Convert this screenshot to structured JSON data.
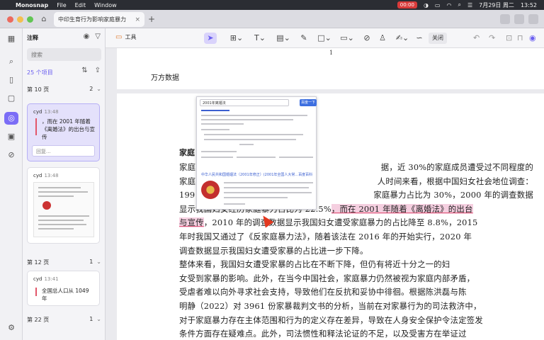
{
  "menubar": {
    "app_name": "Monosnap",
    "menus": [
      "File",
      "Edit",
      "Window"
    ],
    "recording": "00:00",
    "datetime": "7月29日 周二",
    "clock": "13:52"
  },
  "tab": {
    "title": "中印生育行为影响家庭暴力",
    "close": "×",
    "add": "+"
  },
  "panel": {
    "title": "注释",
    "search_placeholder": "搜索",
    "count_label": "25 个项目",
    "sections": [
      {
        "page": "第 10 页",
        "count": "2",
        "cards": [
          {
            "user": "cyd",
            "time": "13:48",
            "text": "，而在 2001 年随着《离婚法》的出台与宣传",
            "reply_placeholder": "回复..."
          },
          {
            "user": "cyd",
            "time": "13:48"
          }
        ]
      },
      {
        "page": "第 12 页",
        "count": "1",
        "cards": [
          {
            "user": "cyd",
            "time": "13:41",
            "text": "全国总人口从 1049 年"
          }
        ]
      },
      {
        "page": "第 22 页",
        "count": "1"
      }
    ]
  },
  "toolbar": {
    "label": "工具",
    "close_label": "关闭"
  },
  "document": {
    "page_number": "1",
    "header_text": "万方数据",
    "heading_fragment": "家庭",
    "lines": [
      {
        "before": "家庭",
        "highlight": "",
        "after": "",
        "right": "据，近 30%的家庭成员遭受过不同程度的"
      },
      {
        "before": "家庭",
        "highlight": "",
        "after": "",
        "right": "人时间来看，根据中国妇女社会地位调查："
      },
      {
        "before": "199",
        "highlight": "",
        "after": "",
        "right": "家庭暴力占比为 30%，2000 年的调查数据"
      },
      {
        "before": "显示我国妇女经历家庭暴力占比为 22.5%",
        "highlight": "，而在 2001 年随着《离婚法》的出台",
        "after": "",
        "right": ""
      },
      {
        "before": "",
        "highlight": "与宣传",
        "after": "，2010 年的调查数据显示我国妇女遭受家庭暴力的占比降至 8.8%，2015",
        "right": ""
      },
      {
        "before": "年时我国又通过了《反家庭暴力法》，随着该法在 2016 年的开始实行，2020 年",
        "highlight": "",
        "after": "",
        "right": ""
      },
      {
        "before": "调查数据显示我国妇女遭受家暴的占比进一步下降。",
        "highlight": "",
        "after": "",
        "right": ""
      },
      {
        "before": "    整体来看，我国妇女遭受家暴的占比在不断下降，但仍有将近十分之一的妇",
        "highlight": "",
        "after": "",
        "right": ""
      },
      {
        "before": "女受到家暴的影响。此外，在当今中国社会，家庭暴力仍然被视为家庭内部矛盾，",
        "highlight": "",
        "after": "",
        "right": ""
      },
      {
        "before": "受虐者难以向外寻求社会支持，导致他们在反抗和妥协中徘徊。根据陈洪磊与陈",
        "highlight": "",
        "after": "",
        "right": ""
      },
      {
        "before": "明静（2022）对 3961 份家暴裁判文书的分析，当前在对家暴行为的司法救济中，",
        "highlight": "",
        "after": "",
        "right": ""
      },
      {
        "before": "对于家庭暴力存在主体范围和行为的定义存在差异，导致在人身安全保护令法定签发",
        "highlight": "",
        "after": "",
        "right": ""
      },
      {
        "before": "条件方面存在疑难点。此外，司法惯性和释法论证的不足，以及受害方在举证过",
        "highlight": "",
        "after": "",
        "right": ""
      }
    ]
  },
  "overlay": {
    "search_text": "2001年离婚法",
    "search_button": "百度一下",
    "link": "中华人民共和国婚姻法（2001年修正）(2001年全国人大常...百度百科"
  },
  "colors": {
    "accent": "#6a5ef0",
    "highlight": "#f5cfe0",
    "underline": "#e25a7a"
  }
}
